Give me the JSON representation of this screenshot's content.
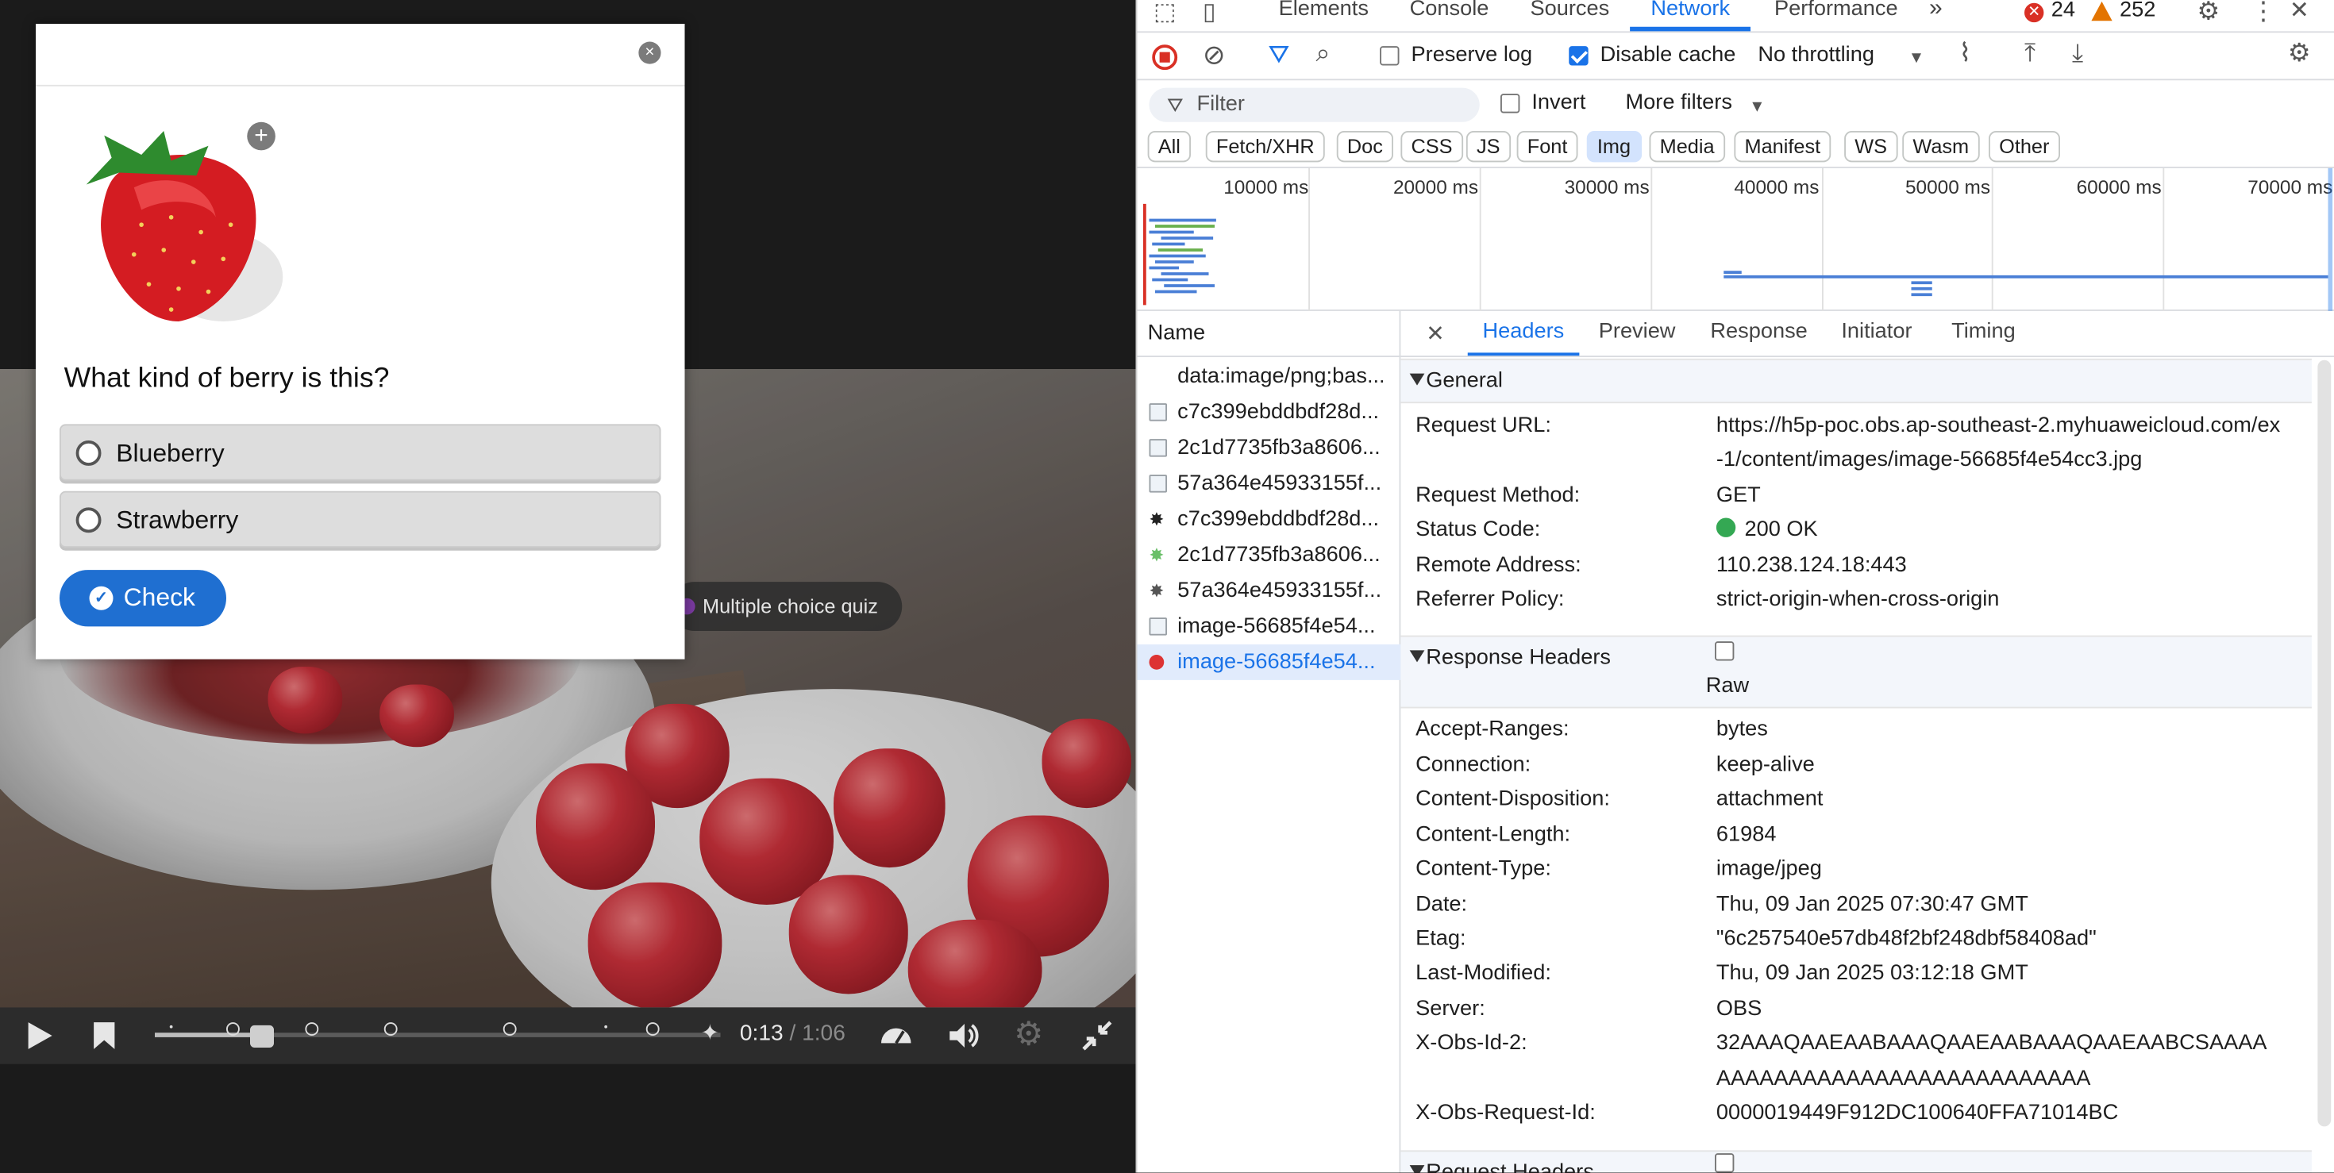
{
  "quiz": {
    "question": "What kind of berry is this?",
    "options": [
      "Blueberry",
      "Strawberry"
    ],
    "check_label": "Check",
    "close_label": "×",
    "expand_label": "+"
  },
  "player": {
    "interaction_chip": "Multiple choice quiz",
    "current_time": "0:13",
    "separator": " / ",
    "duration": "1:06",
    "progress": 0.19
  },
  "devtools": {
    "tabs": [
      "Elements",
      "Console",
      "Sources",
      "Network",
      "Performance"
    ],
    "active_tab": "Network",
    "more_tabs": "»",
    "error_count": "24",
    "warning_count": "252",
    "toolbar": {
      "preserve_log": "Preserve log",
      "disable_cache": "Disable cache",
      "throttling": "No throttling"
    },
    "filter": {
      "placeholder": "Filter",
      "invert": "Invert",
      "more_filters": "More filters"
    },
    "type_chips": [
      "All",
      "Fetch/XHR",
      "Doc",
      "CSS",
      "JS",
      "Font",
      "Img",
      "Media",
      "Manifest",
      "WS",
      "Wasm",
      "Other"
    ],
    "active_chip": "Img",
    "timeline_labels": [
      "10000 ms",
      "20000 ms",
      "30000 ms",
      "40000 ms",
      "50000 ms",
      "60000 ms",
      "70000 ms"
    ],
    "name_header": "Name",
    "requests": [
      "data:image/png;bas...",
      "c7c399ebddbdf28d...",
      "2c1d7735fb3a8606...",
      "57a364e45933155f...",
      "c7c399ebddbdf28d...",
      "2c1d7735fb3a8606...",
      "57a364e45933155f...",
      "image-56685f4e54...",
      "image-56685f4e54..."
    ],
    "detail_tabs": [
      "Headers",
      "Preview",
      "Response",
      "Initiator",
      "Timing"
    ],
    "active_detail_tab": "Headers",
    "general": {
      "title": "General",
      "rows": [
        {
          "k": "Request URL:",
          "v": "https://h5p-poc.obs.ap-southeast-2.myhuaweicloud.com/ex"
        },
        {
          "k": "",
          "v": "-1/content/images/image-56685f4e54cc3.jpg"
        },
        {
          "k": "Request Method:",
          "v": "GET"
        },
        {
          "k": "Status Code:",
          "v": "200 OK"
        },
        {
          "k": "Remote Address:",
          "v": "110.238.124.18:443"
        },
        {
          "k": "Referrer Policy:",
          "v": "strict-origin-when-cross-origin"
        }
      ]
    },
    "response_headers": {
      "title": "Response Headers",
      "raw": "Raw",
      "rows": [
        {
          "k": "Accept-Ranges:",
          "v": "bytes"
        },
        {
          "k": "Connection:",
          "v": "keep-alive"
        },
        {
          "k": "Content-Disposition:",
          "v": "attachment"
        },
        {
          "k": "Content-Length:",
          "v": "61984"
        },
        {
          "k": "Content-Type:",
          "v": "image/jpeg"
        },
        {
          "k": "Date:",
          "v": "Thu, 09 Jan 2025 07:30:47 GMT"
        },
        {
          "k": "Etag:",
          "v": "\"6c257540e57db48f2bf248dbf58408ad\""
        },
        {
          "k": "Last-Modified:",
          "v": "Thu, 09 Jan 2025 03:12:18 GMT"
        },
        {
          "k": "Server:",
          "v": "OBS"
        },
        {
          "k": "X-Obs-Id-2:",
          "v": "32AAAQAAEAABAAAQAAEAABAAAQAAEAABCSAAAA"
        },
        {
          "k": "",
          "v": "AAAAAAAAAAAAAAAAAAAAAAAAAA"
        },
        {
          "k": "X-Obs-Request-Id:",
          "v": "0000019449F912DC100640FFA71014BC"
        }
      ]
    },
    "request_headers_title": "Request Headers",
    "colors": {
      "accent": "#1a73e8",
      "status_ok": "#34a853",
      "error": "#d93025",
      "warning": "#e37400"
    }
  }
}
